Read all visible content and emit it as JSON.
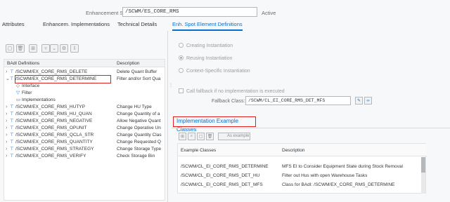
{
  "header": {
    "spot_label": "Enhancement Spot:",
    "spot_value": "/SCWM/ES_CORE_RMS",
    "status": "Active"
  },
  "tabs": [
    {
      "label": "Attributes"
    },
    {
      "label": "Enhancem. Implementations"
    },
    {
      "label": "Technical Details"
    },
    {
      "label": "Enh. Spot Element Definitions",
      "active": true
    }
  ],
  "tree": {
    "col_name": "BAdI Definitions",
    "col_desc": "Description",
    "rows": [
      {
        "name": "/SCWM/EX_CORE_RMS_DELETE",
        "desc": "Delete Quant Buffer"
      },
      {
        "name": "/SCWM/EX_CORE_RMS_DETERMINE",
        "desc": "Filter and/or Sort Qua",
        "expanded": true
      },
      {
        "name": "Interface",
        "desc": ""
      },
      {
        "name": "Filter",
        "desc": ""
      },
      {
        "name": "Implementations",
        "desc": ""
      },
      {
        "name": "/SCWM/EX_CORE_RMS_HUTYP",
        "desc": "Change HU Type"
      },
      {
        "name": "/SCWM/EX_CORE_RMS_HU_QUAN",
        "desc": "Change Quantity of a"
      },
      {
        "name": "/SCWM/EX_CORE_RMS_NEGATIVE",
        "desc": "Allow Negative Quant"
      },
      {
        "name": "/SCWM/EX_CORE_RMS_OPUNIT",
        "desc": "Change Operative Un"
      },
      {
        "name": "/SCWM/EX_CORE_RMS_QCLA_STR",
        "desc": "Change Quantity Clas"
      },
      {
        "name": "/SCWM/EX_CORE_RMS_QUANTITY",
        "desc": "Change Requested Q"
      },
      {
        "name": "/SCWM/EX_CORE_RMS_STRATEGY",
        "desc": "Change Storage Type"
      },
      {
        "name": "/SCWM/EX_CORE_RMS_VERIFY",
        "desc": "Check Storage Bin"
      }
    ]
  },
  "instantiation": {
    "creating": "Creating Instantiation",
    "reusing": "Reusing Instantiation",
    "context": "Context-Specific Instantiation",
    "selected": "reusing"
  },
  "fallback": {
    "checkbox_label": "Call fallback if no implementation is executed",
    "class_label": "Fallback Class:",
    "class_value": "/SCWM/CL_EI_CORE_RMS_DET_MFS"
  },
  "impl_examples": {
    "title": "Implementation Example Classes",
    "as_example_label": "As example",
    "col_class": "Example Classes",
    "col_desc": "Description",
    "rows": [
      {
        "cls": "/SCWM/CL_EI_CORE_RMS_DETERMINE",
        "desc": "MFS EI to Consider Equipment State during Stock Removal"
      },
      {
        "cls": "/SCWM/CL_EI_CORE_RMS_DET_HU",
        "desc": "Filter out Hus with open Warehouse Tasks"
      },
      {
        "cls": "/SCWM/CL_EI_CORE_RMS_DET_MFS",
        "desc": "Class for BAdI: /SCWM/EX_CORE_RMS_DETERMINE"
      }
    ]
  },
  "colors": {
    "accent": "#0a6ed1",
    "highlight": "#e02020"
  }
}
